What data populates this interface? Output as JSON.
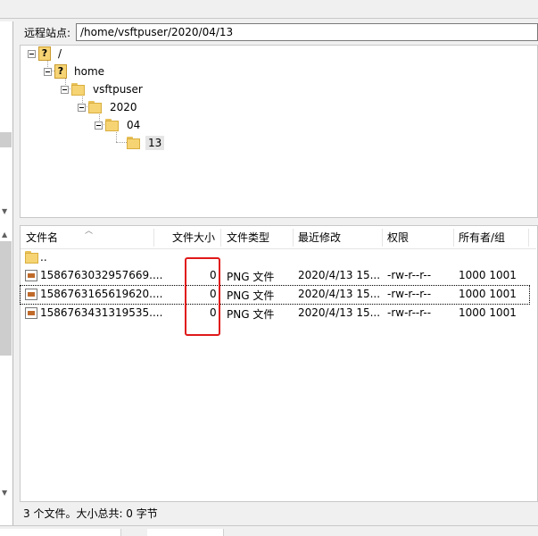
{
  "remote_bar": {
    "label": "远程站点:",
    "path": "/home/vsftpuser/2020/04/13"
  },
  "tree": {
    "nodes": [
      {
        "label": "/",
        "icon": "unknown-folder-icon"
      },
      {
        "label": "home",
        "icon": "unknown-folder-icon"
      },
      {
        "label": "vsftpuser",
        "icon": "folder-icon"
      },
      {
        "label": "2020",
        "icon": "folder-icon"
      },
      {
        "label": "04",
        "icon": "folder-icon"
      },
      {
        "label": "13",
        "icon": "folder-icon",
        "selected": true
      }
    ]
  },
  "file_list": {
    "columns": [
      "文件名",
      "文件大小",
      "文件类型",
      "最近修改",
      "权限",
      "所有者/组"
    ],
    "updir": "..",
    "rows": [
      {
        "name": "1586763032957669....",
        "size": "0",
        "type": "PNG 文件",
        "modified": "2020/4/13 15...",
        "perms": "-rw-r--r--",
        "owner": "1000 1001"
      },
      {
        "name": "1586763165619620....",
        "size": "0",
        "type": "PNG 文件",
        "modified": "2020/4/13 15...",
        "perms": "-rw-r--r--",
        "owner": "1000 1001"
      },
      {
        "name": "1586763431319535....",
        "size": "0",
        "type": "PNG 文件",
        "modified": "2020/4/13 15...",
        "perms": "-rw-r--r--",
        "owner": "1000 1001"
      }
    ]
  },
  "status": {
    "text": "3 个文件。大小总共: 0 字节"
  },
  "colors": {
    "highlight_box": "#e0191a",
    "folder": "#f6d474"
  }
}
